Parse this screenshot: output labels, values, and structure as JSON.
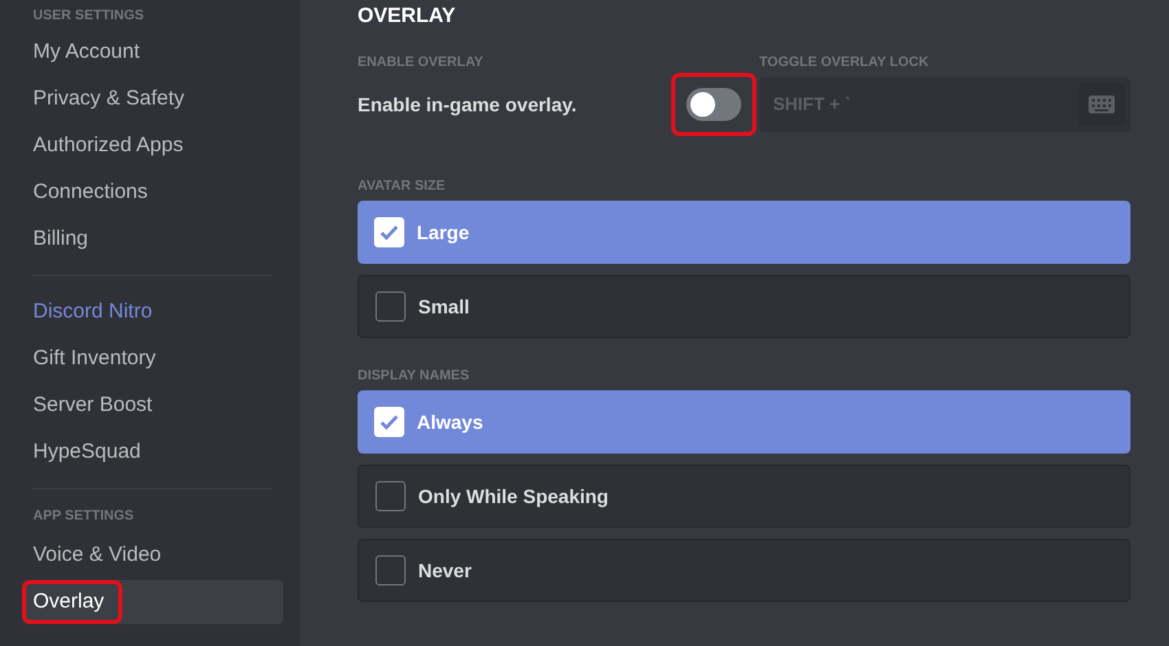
{
  "sidebar": {
    "sections": [
      {
        "header": "USER SETTINGS",
        "items": [
          {
            "label": "My Account",
            "selected": false,
            "kind": "plain",
            "highlighted": false
          },
          {
            "label": "Privacy & Safety",
            "selected": false,
            "kind": "plain",
            "highlighted": false
          },
          {
            "label": "Authorized Apps",
            "selected": false,
            "kind": "plain",
            "highlighted": false
          },
          {
            "label": "Connections",
            "selected": false,
            "kind": "plain",
            "highlighted": false
          },
          {
            "label": "Billing",
            "selected": false,
            "kind": "plain",
            "highlighted": false
          }
        ]
      },
      {
        "items": [
          {
            "label": "Discord Nitro",
            "selected": false,
            "kind": "nitro",
            "highlighted": false
          },
          {
            "label": "Gift Inventory",
            "selected": false,
            "kind": "plain",
            "highlighted": false
          },
          {
            "label": "Server Boost",
            "selected": false,
            "kind": "plain",
            "highlighted": false
          },
          {
            "label": "HypeSquad",
            "selected": false,
            "kind": "plain",
            "highlighted": false
          }
        ]
      },
      {
        "header": "APP SETTINGS",
        "items": [
          {
            "label": "Voice & Video",
            "selected": false,
            "kind": "plain",
            "highlighted": false
          },
          {
            "label": "Overlay",
            "selected": true,
            "kind": "plain",
            "highlighted": true
          }
        ]
      }
    ]
  },
  "content": {
    "title": "OVERLAY",
    "enable_overlay": {
      "header": "ENABLE OVERLAY",
      "label": "Enable in-game overlay.",
      "on": false,
      "highlighted": true
    },
    "overlay_lock": {
      "header": "TOGGLE OVERLAY LOCK",
      "value": "SHIFT + `"
    },
    "groups": [
      {
        "header": "AVATAR SIZE",
        "options": [
          {
            "label": "Large",
            "selected": true
          },
          {
            "label": "Small",
            "selected": false
          }
        ]
      },
      {
        "header": "DISPLAY NAMES",
        "options": [
          {
            "label": "Always",
            "selected": true
          },
          {
            "label": "Only While Speaking",
            "selected": false
          },
          {
            "label": "Never",
            "selected": false
          }
        ]
      }
    ]
  }
}
